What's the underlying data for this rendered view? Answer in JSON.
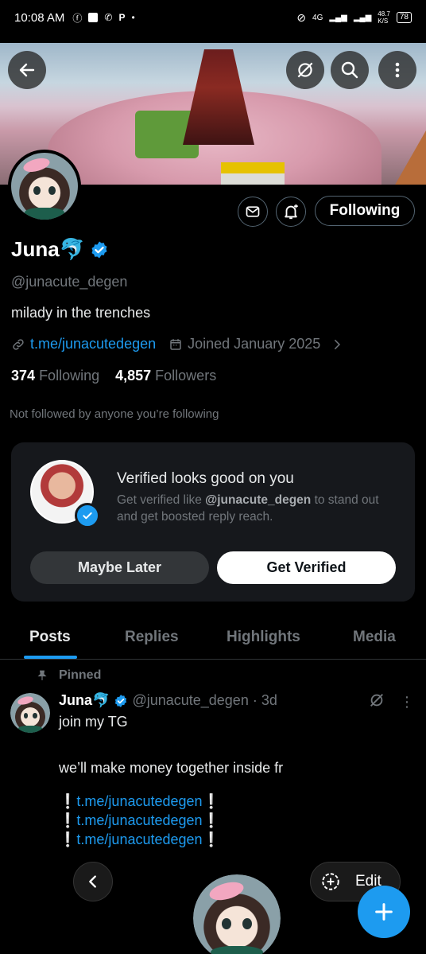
{
  "status_bar": {
    "time": "10:08 AM",
    "network": "4G",
    "speed": "48.7",
    "speed_unit": "K/S",
    "battery": "78"
  },
  "profile": {
    "name": "Juna🐬",
    "handle": "@junacute_degen",
    "bio": "milady in the trenches",
    "link": "t.me/junacutedegen",
    "joined": "Joined January 2025",
    "following_count": "374",
    "following_label": "Following",
    "followers_count": "4,857",
    "followers_label": "Followers",
    "not_followed_note": "Not followed by anyone you’re following",
    "follow_button": "Following"
  },
  "verified_card": {
    "title": "Verified looks good on you",
    "subtitle_prefix": "Get verified like ",
    "subtitle_handle": "@junacute_degen",
    "subtitle_suffix": " to stand out and get boosted reply reach.",
    "maybe_later": "Maybe Later",
    "get_verified": "Get Verified"
  },
  "tabs": [
    "Posts",
    "Replies",
    "Highlights",
    "Media"
  ],
  "post": {
    "pinned_label": "Pinned",
    "author_name": "Juna🐬",
    "author_handle": "@junacute_degen",
    "age": "· 3d",
    "line1": "join my TG",
    "line2": "we’ll make money together inside fr",
    "links": [
      "t.me/junacutedegen",
      "t.me/junacutedegen",
      "t.me/junacutedegen"
    ],
    "bang": "❕"
  },
  "bottom": {
    "edit_label": "Edit"
  },
  "colors": {
    "accent": "#1d9bf0",
    "muted": "#71767b",
    "background": "#000000",
    "card": "#16181c"
  }
}
